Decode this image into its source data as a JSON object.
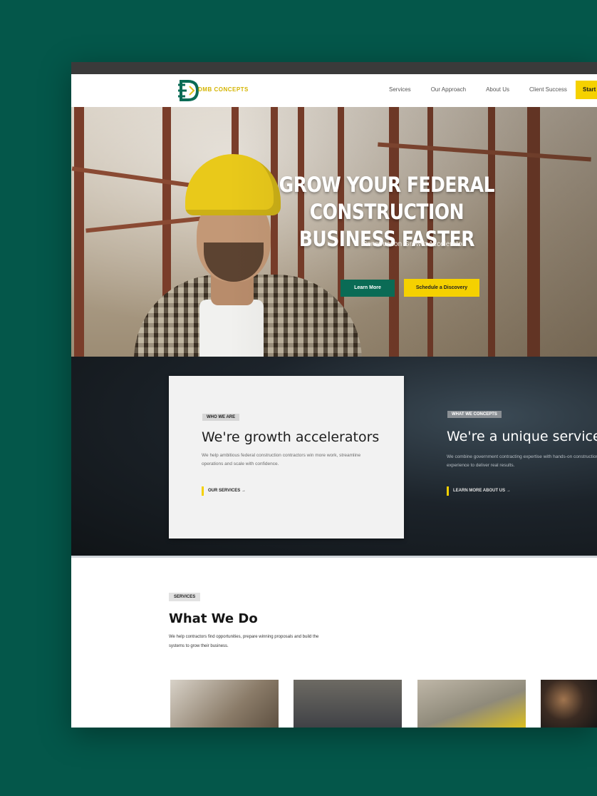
{
  "colors": {
    "page_background": "#04574a",
    "brand_green": "#0a6b55",
    "brand_yellow": "#f5d100",
    "dark_band": "#1c232a"
  },
  "header": {
    "logo_text": "DMB CONCEPTS",
    "nav": [
      "Services",
      "Our Approach",
      "About Us",
      "Client Success"
    ],
    "cta_label": "Start"
  },
  "hero": {
    "title_line1": "GROW YOUR FEDERAL CONSTRUCTION",
    "title_line2": "BUSINESS FASTER",
    "subtitle": "Construction Growth Accelerator",
    "primary_button": "Learn More",
    "secondary_button": "Schedule a Discovery"
  },
  "band": {
    "left": {
      "tag": "WHO WE ARE",
      "title": "We're growth accelerators",
      "body": "We help ambitious federal construction contractors win more work, streamline operations and scale with confidence.",
      "link": "OUR SERVICES →"
    },
    "right": {
      "tag": "WHAT WE CONCEPTS",
      "title": "We're a unique service",
      "body": "We combine government contracting expertise with hands-on construction experience to deliver real results.",
      "link": "LEARN MORE ABOUT US →"
    }
  },
  "what_we_do": {
    "tag": "SERVICES",
    "title": "What We Do",
    "body": "We help contractors find opportunities, prepare winning proposals and build the systems to grow their business."
  }
}
